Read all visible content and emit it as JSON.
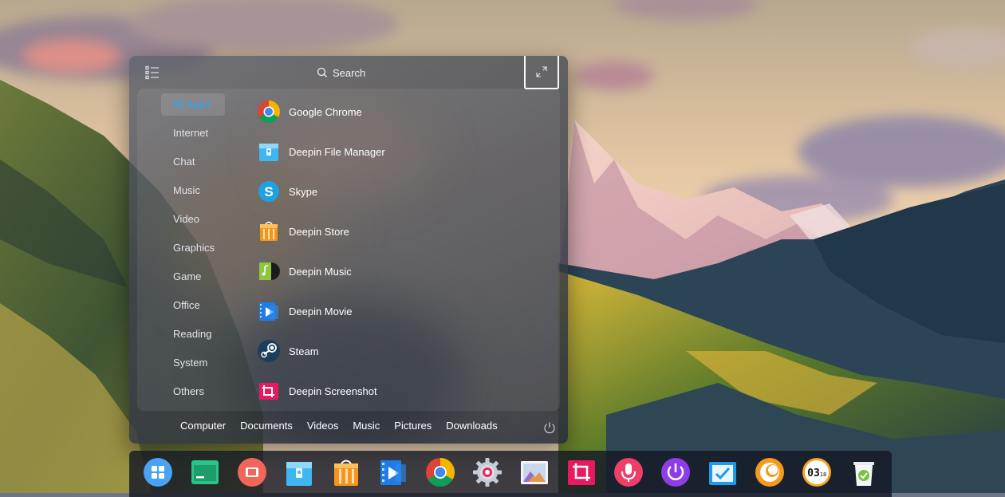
{
  "launcher": {
    "search_label": "Search",
    "categories": [
      {
        "label": "All Apps",
        "active": true
      },
      {
        "label": "Internet"
      },
      {
        "label": "Chat"
      },
      {
        "label": "Music"
      },
      {
        "label": "Video"
      },
      {
        "label": "Graphics"
      },
      {
        "label": "Game"
      },
      {
        "label": "Office"
      },
      {
        "label": "Reading"
      },
      {
        "label": "System"
      },
      {
        "label": "Others"
      }
    ],
    "apps": [
      {
        "label": "Google Chrome",
        "icon": "chrome-icon"
      },
      {
        "label": "Deepin File Manager",
        "icon": "file-manager-icon"
      },
      {
        "label": "Skype",
        "icon": "skype-icon"
      },
      {
        "label": "Deepin Store",
        "icon": "store-icon"
      },
      {
        "label": "Deepin Music",
        "icon": "music-icon"
      },
      {
        "label": "Deepin Movie",
        "icon": "movie-icon"
      },
      {
        "label": "Steam",
        "icon": "steam-icon"
      },
      {
        "label": "Deepin Screenshot",
        "icon": "screenshot-icon"
      }
    ],
    "places": [
      "Computer",
      "Documents",
      "Videos",
      "Music",
      "Pictures",
      "Downloads"
    ]
  },
  "dock": {
    "items": [
      "launcher-icon",
      "terminal-icon",
      "screen-recorder-icon",
      "file-manager-icon",
      "store-icon",
      "movie-icon",
      "chrome-icon",
      "settings-icon",
      "image-viewer-icon",
      "screenshot-icon",
      "voice-recorder-icon",
      "shutdown-icon",
      "system-monitor-icon",
      "browser-ring-icon",
      "clock-icon",
      "trash-icon"
    ],
    "clock": {
      "hour": "03",
      "min": "18"
    }
  },
  "colors": {
    "accent": "#2ca7f8",
    "panel": "#3e424c",
    "dock": "#161a26"
  }
}
